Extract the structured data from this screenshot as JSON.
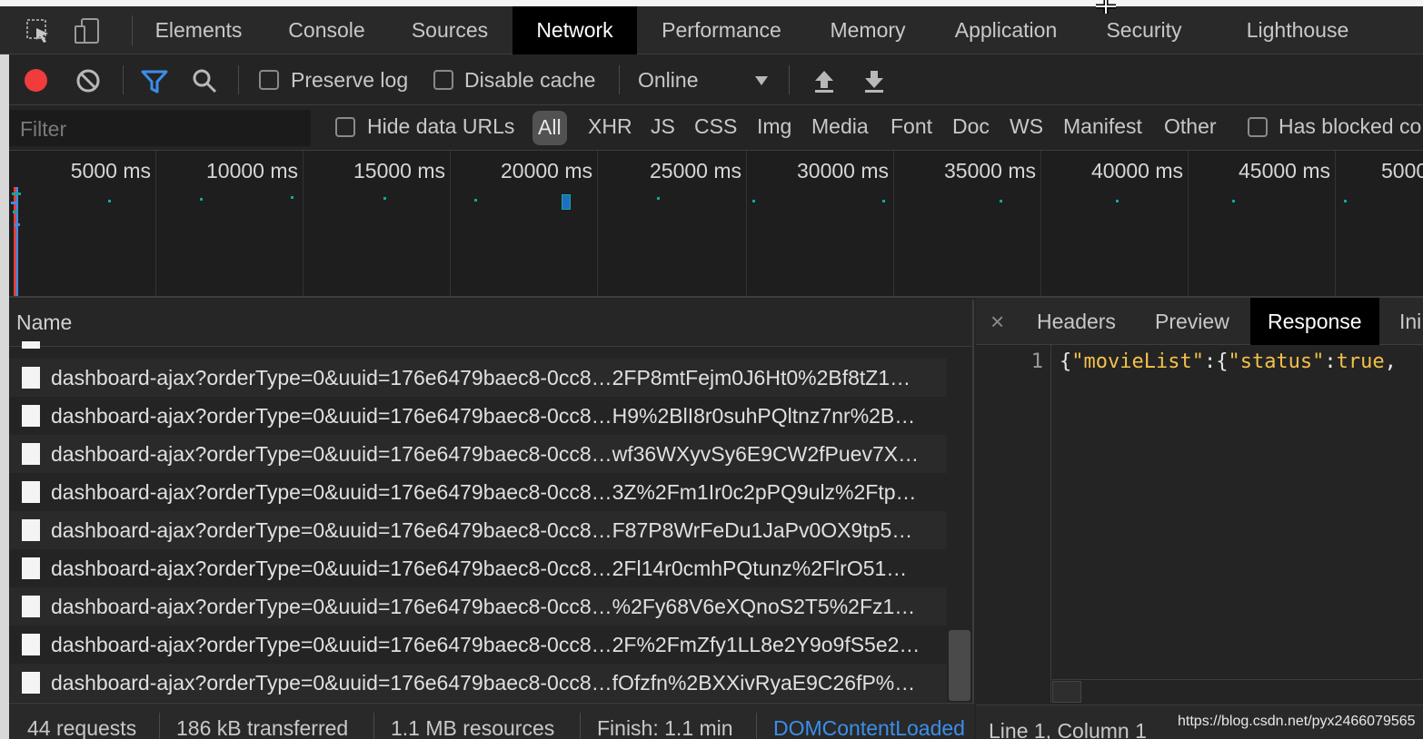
{
  "tabs": [
    {
      "label": "Elements"
    },
    {
      "label": "Console"
    },
    {
      "label": "Sources"
    },
    {
      "label": "Network"
    },
    {
      "label": "Performance"
    },
    {
      "label": "Memory"
    },
    {
      "label": "Application"
    },
    {
      "label": "Security"
    },
    {
      "label": "Lighthouse"
    }
  ],
  "active_tab": "Network",
  "toolbar": {
    "preserve_log": "Preserve log",
    "disable_cache": "Disable cache",
    "throttle": "Online",
    "preserve_log_checked": false,
    "disable_cache_checked": false
  },
  "filter": {
    "placeholder": "Filter",
    "hide_data_urls": "Hide data URLs",
    "types": [
      "All",
      "XHR",
      "JS",
      "CSS",
      "Img",
      "Media",
      "Font",
      "Doc",
      "WS",
      "Manifest",
      "Other"
    ],
    "has_blocked": "Has blocked co"
  },
  "overview": {
    "ticks": [
      "5000 ms",
      "10000 ms",
      "15000 ms",
      "20000 ms",
      "25000 ms",
      "30000 ms",
      "35000 ms",
      "40000 ms",
      "45000 ms",
      "5000"
    ]
  },
  "list": {
    "header": "Name",
    "rows": [
      "dashboard-ajax?orderType=0&uuid=176e6479baec8-0cc8…2FP8mtFejm0J6Ht0%2Bf8tZ1…",
      "dashboard-ajax?orderType=0&uuid=176e6479baec8-0cc8…H9%2BlI8r0suhPQltnz7nr%2B…",
      "dashboard-ajax?orderType=0&uuid=176e6479baec8-0cc8…wf36WXyvSy6E9CW2fPuev7X…",
      "dashboard-ajax?orderType=0&uuid=176e6479baec8-0cc8…3Z%2Fm1Ir0c2pPQ9ulz%2Ftp…",
      "dashboard-ajax?orderType=0&uuid=176e6479baec8-0cc8…F87P8WrFeDu1JaPv0OX9tp5…",
      "dashboard-ajax?orderType=0&uuid=176e6479baec8-0cc8…2Fl14r0cmhPQtunz%2FlrO51…",
      "dashboard-ajax?orderType=0&uuid=176e6479baec8-0cc8…%2Fy68V6eXQnoS2T5%2Fz1…",
      "dashboard-ajax?orderType=0&uuid=176e6479baec8-0cc8…2F%2FmZfy1LL8e2Y9o9fS5e2…",
      "dashboard-ajax?orderType=0&uuid=176e6479baec8-0cc8…fOfzfn%2BXXivRyaE9C26fP%…"
    ]
  },
  "details": {
    "close": "×",
    "tabs": [
      {
        "label": "Headers"
      },
      {
        "label": "Preview"
      },
      {
        "label": "Response"
      },
      {
        "label": "Ini"
      }
    ],
    "active_tab": "Response",
    "line_number": "1",
    "code": {
      "p1": "{",
      "key1": "\"movieList\"",
      "p2": ":{",
      "key2": "\"status\"",
      "p3": ":",
      "val": "true",
      "p4": ","
    },
    "position": "Line 1, Column 1"
  },
  "status": {
    "requests": "44 requests",
    "transferred": "186 kB transferred",
    "resources": "1.1 MB resources",
    "finish": "Finish: 1.1 min",
    "domcontent": "DOMContentLoaded"
  },
  "watermark": "https://blog.csdn.net/pyx2466079565",
  "colors": {
    "record": "#f03c3c",
    "filter_active": "#3b8eea",
    "link": "#3b8eea",
    "timeline_dot": "#12a79b",
    "json_string": "#f4c04a"
  }
}
